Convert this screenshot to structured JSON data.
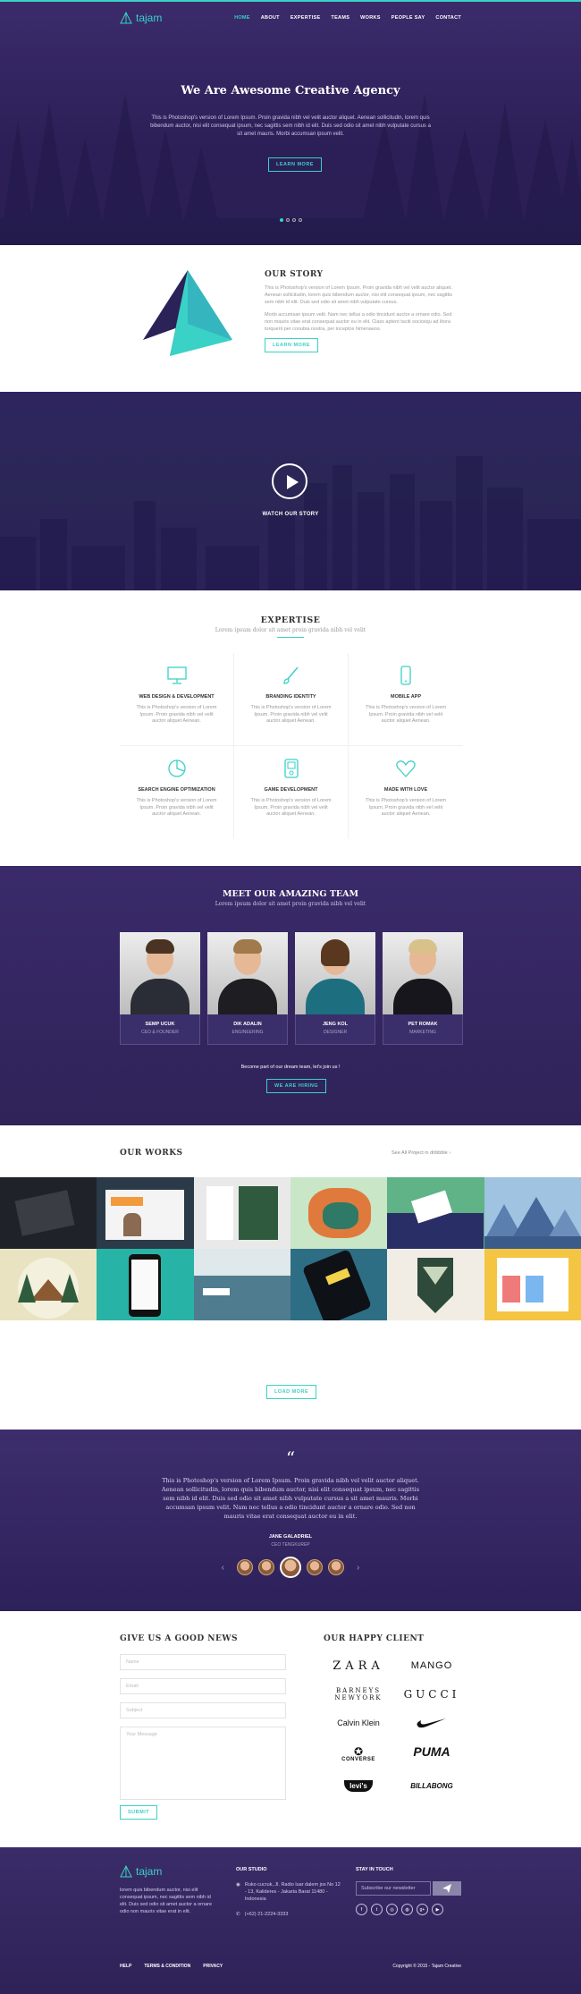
{
  "nav": {
    "brand": "tajam",
    "items": [
      "HOME",
      "ABOUT",
      "EXPERTISE",
      "TEAMS",
      "WORKS",
      "PEOPLE SAY",
      "CONTACT"
    ],
    "active": "HOME"
  },
  "hero": {
    "title": "We Are Awesome Creative Agency",
    "text": "This is Photoshop's version of Lorem Ipsum. Proin gravida nibh vel velit auctor aliquet. Aenean sollicitudin, lorem quis bibendum auctor, nisi elit consequat ipsum, nec sagittis sem nibh id elit. Duis sed odio sit amet nibh vulputate cursus a sit amet mauris. Morbi accumsan ipsum velit.",
    "button": "LEARN MORE"
  },
  "story": {
    "title": "OUR STORY",
    "p1": "This is Photoshop's version of Lorem Ipsum. Proin gravida nibh vel velit auctor aliquet. Aenean sollicitudin, lorem quis bibendum auctor, nisi elit consequat ipsum, nec sagittis sem nibh id elit. Duis sed odio sit amet nibh vulputate cursus.",
    "p2": "Morbi accumsan ipsum velit. Nam nec tellus a odio tincidunt auctor a ornare odio. Sed non mauris vitae erat consequat auctor eu in elit. Class aptent taciti sociosqu ad litora torquent per conubia nostra, per inceptos himenaeos.",
    "button": "LEARN MORE"
  },
  "video": {
    "label": "WATCH OUR STORY"
  },
  "expertise": {
    "title": "EXPERTISE",
    "subtitle": "Lorem ipsum dolor sit amet proin gravida nibh vel velit",
    "items": [
      {
        "title": "WEB DESIGN & DEVELOPMENT",
        "text": "This is Photoshop's version of Lorem Ipsum. Proin gravida nibh vel velit auctor aliquet Aenean.",
        "icon": "monitor-icon"
      },
      {
        "title": "BRANDING IDENTITY",
        "text": "This is Photoshop's version of Lorem Ipsum. Proin gravida nibh vel velit auctor aliquet Aenean.",
        "icon": "brush-icon"
      },
      {
        "title": "MOBILE APP",
        "text": "This is Photoshop's version of Lorem Ipsum. Proin gravida nibh vel velit auctor aliquet Aenean.",
        "icon": "phone-icon"
      },
      {
        "title": "SEARCH ENGINE OPTIMIZATION",
        "text": "This is Photoshop's version of Lorem Ipsum. Proin gravida nibh vel velit auctor aliquet Aenean.",
        "icon": "pie-chart-icon"
      },
      {
        "title": "GAME DEVELOPMENT",
        "text": "This is Photoshop's version of Lorem Ipsum. Proin gravida nibh vel velit auctor aliquet Aenean.",
        "icon": "gamepad-icon"
      },
      {
        "title": "MADE WITH LOVE",
        "text": "This is Photoshop's version of Lorem Ipsum. Proin gravida nibh vel velit auctor aliquet Aenean.",
        "icon": "heart-icon"
      }
    ]
  },
  "team": {
    "title": "MEET OUR AMAZING TEAM",
    "subtitle": "Lorem ipsum dolor sit amet proin gravida nibh vel velit",
    "members": [
      {
        "name": "SEMP UCUK",
        "role": "CEO & FOUNDER"
      },
      {
        "name": "DIK ADALIN",
        "role": "ENGINEERING"
      },
      {
        "name": "JENG KOL",
        "role": "DESIGNER"
      },
      {
        "name": "PET ROMAK",
        "role": "MARKETING"
      }
    ],
    "join_text": "Become part of our dream team, let's join us !",
    "button": "WE ARE HIRING"
  },
  "works": {
    "title": "OUR WORKS",
    "link": "See All Project in dribbble",
    "button": "LOAD MORE"
  },
  "testimonial": {
    "quote_mark": "“",
    "text": "This is Photoshop's version of Lorem Ipsum. Proin gravida nibh vel velit auctor aliquet. Aenean sollicitudin, lorem quis bibendum auctor, nisi elit consequat ipsum, nec sagittis sem nibh id elit. Duis sed odio sit amet nibh vulputate cursus a sit amet mauris. Morbi accumsan ipsum velit. Nam nec tellus a odio tincidunt auctor a ornare odio. Sed non mauris vitae erat consequat auctor eu in elit.",
    "name": "JANE GALADRIEL",
    "role": "CEO TENGKUREP"
  },
  "contact": {
    "title": "GIVE US A GOOD NEWS",
    "name_ph": "Name",
    "email_ph": "Email",
    "subject_ph": "Subject",
    "message_ph": "Your Message",
    "submit": "SUBMIT"
  },
  "clients": {
    "title": "OUR HAPPY CLIENT",
    "logos": [
      "ZARA",
      "MANGO",
      "BARNEYS NEWYORK",
      "GUCCI",
      "Calvin Klein",
      "nike",
      "CONVERSE",
      "PUMA",
      "levi's",
      "BILLABONG"
    ]
  },
  "footer": {
    "brand": "tajam",
    "about": "lorem quis bibendum auctor, nisi elit consequat ipsum, nec sagittis sem nibh id elit. Duis sed odio sit amet auctor a ornare odio non mauris vitae erat in elit.",
    "studio_title": "OUR STUDIO",
    "address": "Ruko cucruk, Jl. Radio luar dalem jos No 12 - 13, Kalideres - Jakarta Barat 11480 - Indonesia",
    "phone": "(+62) 21-2224-3333",
    "touch_title": "STAY IN TOUCH",
    "newsletter_ph": "Subscribe our newsletter",
    "links": [
      "HELP",
      "TERMS & CONDITION",
      "PRIVACY"
    ],
    "copyright": "Copyright © 2015 - Tajam Creative"
  },
  "colors": {
    "accent": "#3ad1c6",
    "purple_dark": "#2c1f57",
    "purple": "#3b2b6b"
  }
}
